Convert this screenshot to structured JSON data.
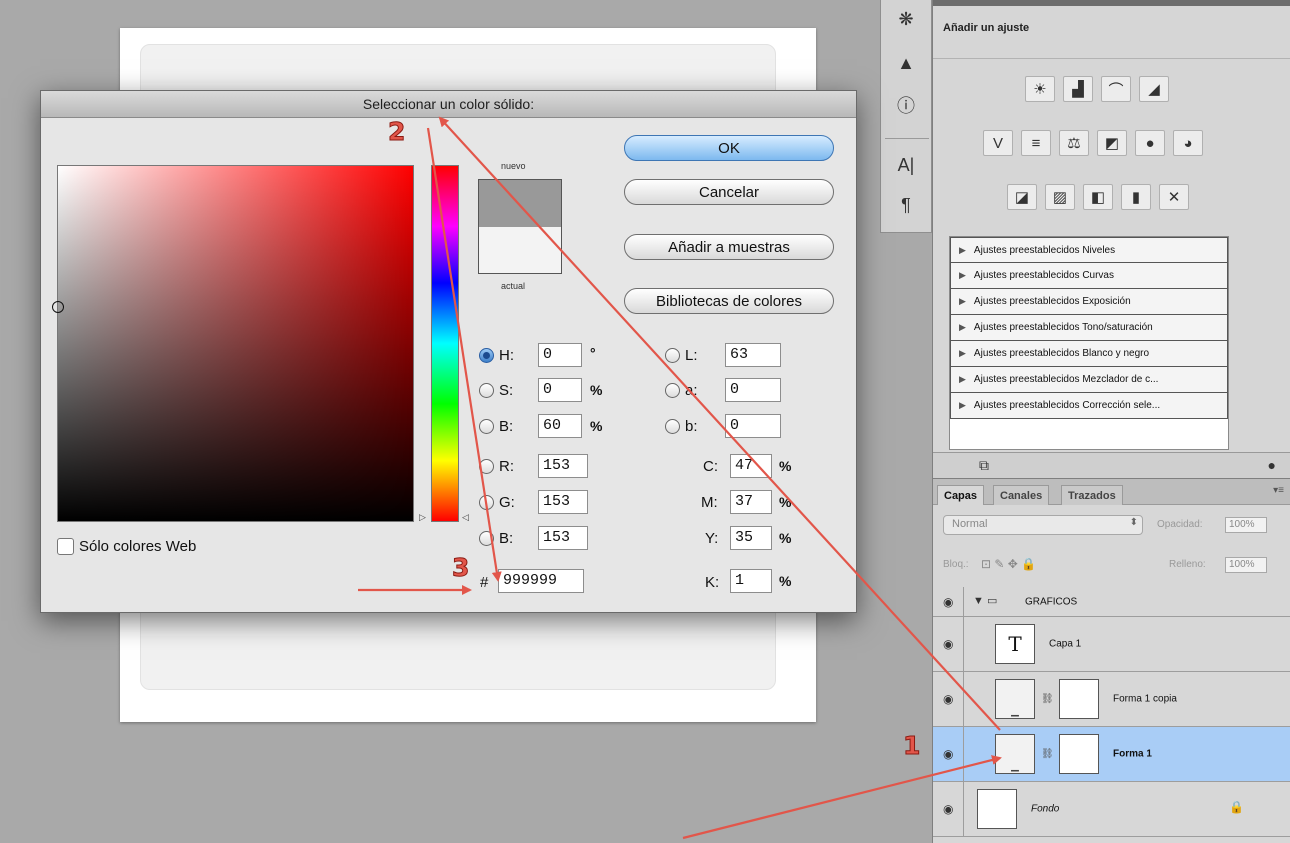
{
  "dialog": {
    "title": "Seleccionar un color sólido:",
    "buttons": {
      "ok": "OK",
      "cancel": "Cancelar",
      "add_swatches": "Añadir a muestras",
      "color_libraries": "Bibliotecas de colores"
    },
    "swatch": {
      "new_label": "nuevo",
      "current_label": "actual",
      "new_color": "#999999",
      "current_color": "#f3f3f3"
    },
    "fields": {
      "H": {
        "label": "H:",
        "value": "0",
        "unit": "°"
      },
      "S": {
        "label": "S:",
        "value": "0",
        "unit": "%"
      },
      "Bv": {
        "label": "B:",
        "value": "60",
        "unit": "%"
      },
      "R": {
        "label": "R:",
        "value": "153"
      },
      "G": {
        "label": "G:",
        "value": "153"
      },
      "Bc": {
        "label": "B:",
        "value": "153"
      },
      "L": {
        "label": "L:",
        "value": "63"
      },
      "a": {
        "label": "a:",
        "value": "0"
      },
      "b": {
        "label": "b:",
        "value": "0"
      },
      "C": {
        "label": "C:",
        "value": "47",
        "unit": "%"
      },
      "M": {
        "label": "M:",
        "value": "37",
        "unit": "%"
      },
      "Y": {
        "label": "Y:",
        "value": "35",
        "unit": "%"
      },
      "K": {
        "label": "K:",
        "value": "1",
        "unit": "%"
      },
      "hex": {
        "label": "#",
        "value": "999999"
      }
    },
    "web_only_label": "Sólo colores Web",
    "hue_color": "#ff0000"
  },
  "adjustments": {
    "title": "Añadir un ajuste",
    "icon_rows": [
      [
        "brightness-icon",
        "levels-icon",
        "curves-icon",
        "exposure-icon"
      ],
      [
        "vibrance-icon",
        "hue-saturation-icon",
        "color-balance-icon",
        "black-white-icon",
        "photo-filter-icon",
        "channel-mixer-icon"
      ],
      [
        "invert-icon",
        "posterize-icon",
        "threshold-icon",
        "gradient-map-icon",
        "selective-color-icon"
      ]
    ],
    "presets": [
      "Ajustes preestablecidos Niveles",
      "Ajustes preestablecidos Curvas",
      "Ajustes preestablecidos Exposición",
      "Ajustes preestablecidos Tono/saturación",
      "Ajustes preestablecidos Blanco y negro",
      "Ajustes preestablecidos Mezclador de c...",
      "Ajustes preestablecidos Corrección sele..."
    ]
  },
  "layers": {
    "tabs": [
      "Capas",
      "Canales",
      "Trazados"
    ],
    "blend_mode": "Normal",
    "opacity_label": "Opacidad:",
    "opacity_value": "100%",
    "lock_label": "Bloq.:",
    "fill_label": "Relleno:",
    "fill_value": "100%",
    "items": [
      {
        "name": "GRAFICOS"
      },
      {
        "name": "Capa 1",
        "thumb": "T"
      },
      {
        "name": "Forma 1 copia"
      },
      {
        "name": "Forma 1"
      },
      {
        "name": "Fondo"
      }
    ],
    "selected_color": "#a9cdf6"
  },
  "annotations": {
    "step1": "1",
    "step2": "2",
    "step3": "3",
    "arrow_color": "#e2564a"
  }
}
